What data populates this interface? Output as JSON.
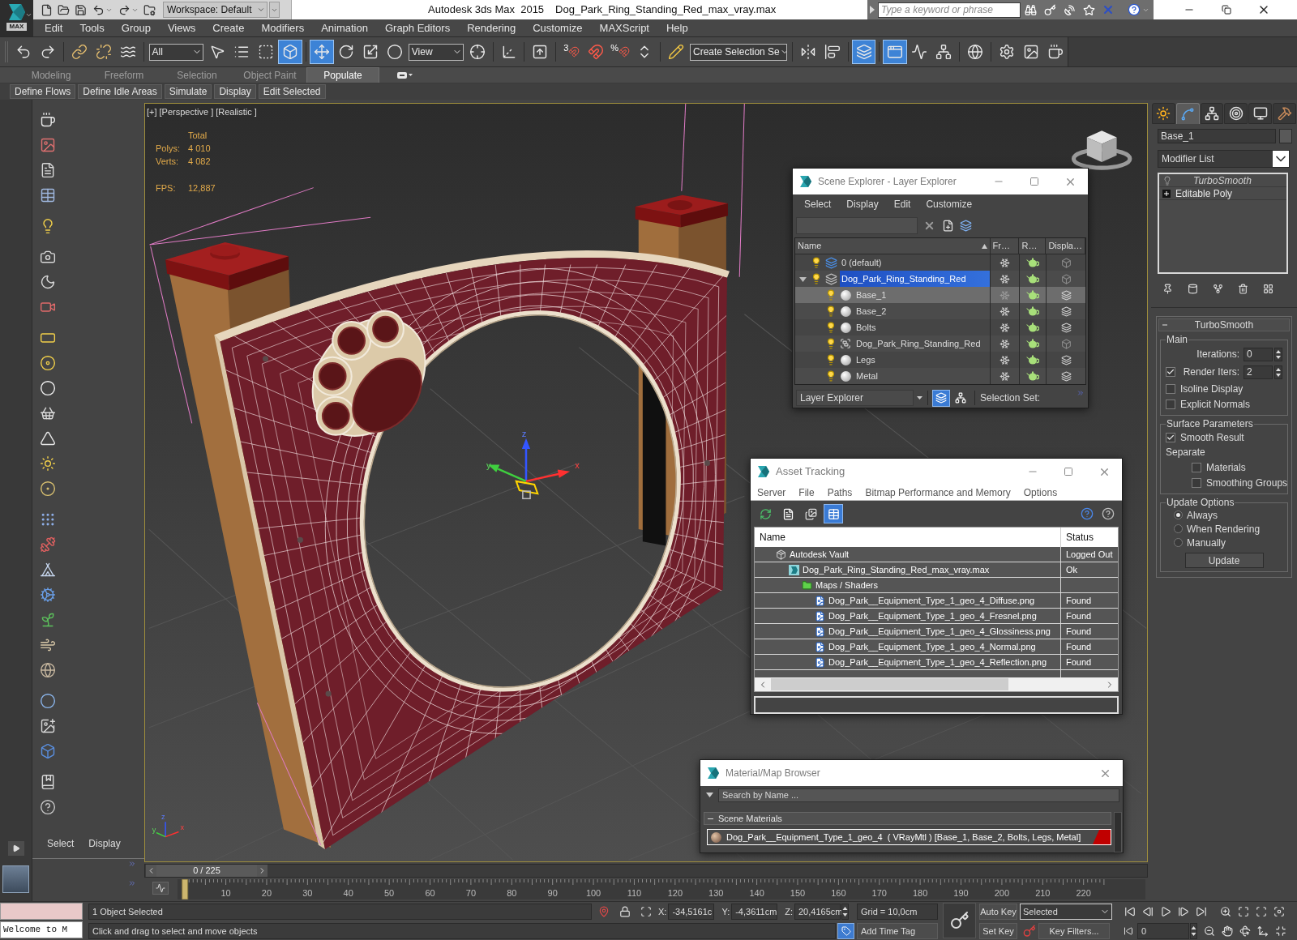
{
  "title_bar": {
    "logo_label": "MAX",
    "workspace": "Workspace: Default",
    "app_title": "Autodesk 3ds Max  2015",
    "file_name": "Dog_Park_Ring_Standing_Red_max_vray.max",
    "search_placeholder": "Type a keyword or phrase"
  },
  "menu_bar": [
    "Edit",
    "Tools",
    "Group",
    "Views",
    "Create",
    "Modifiers",
    "Animation",
    "Graph Editors",
    "Rendering",
    "Customize",
    "MAXScript",
    "Help"
  ],
  "main_toolbar": {
    "selection_filter": "All",
    "reference_coordinate_system": "View",
    "snap_label": "3",
    "percent_snap_label": "%",
    "named_selection_set": "Create Selection Se",
    "buttons": [
      {
        "active": false
      },
      {
        "active": false
      },
      {
        "active": false
      },
      {
        "active": false
      },
      {
        "active": false
      },
      {
        "active": false
      },
      {
        "active": false
      },
      {
        "active": false
      },
      {
        "active": true
      },
      {
        "active": true
      },
      {
        "active": false
      },
      {
        "active": false
      },
      {
        "active": false
      },
      {
        "active": false
      },
      {
        "active": false
      },
      {
        "active": false
      },
      {
        "active": false
      },
      {
        "active": false
      },
      {
        "active": false
      },
      {
        "active": false
      },
      {
        "active": false
      },
      {
        "active": false
      },
      {
        "active": false
      },
      {
        "active": true
      },
      {
        "active": true
      },
      {
        "active": false
      },
      {
        "active": false
      },
      {
        "active": false
      },
      {
        "active": false
      },
      {
        "active": false
      },
      {
        "active": false
      }
    ]
  },
  "ribbon": {
    "tabs": [
      {
        "label": "Modeling",
        "selected": false
      },
      {
        "label": "Freeform",
        "selected": false
      },
      {
        "label": "Selection",
        "selected": false
      },
      {
        "label": "Object Paint",
        "selected": false
      },
      {
        "label": "Populate",
        "selected": true
      }
    ],
    "buttons": [
      "Define Flows",
      "Define Idle Areas",
      "Simulate",
      "Display",
      "Edit Selected"
    ]
  },
  "left_panel": {
    "tabs": [
      "Select",
      "Display"
    ]
  },
  "viewport": {
    "labels": [
      "[+]",
      "[Perspective ]",
      "[Realistic ]"
    ],
    "stats_heading": "Total",
    "stats": [
      {
        "label": "Polys:",
        "value": "4 010"
      },
      {
        "label": "Verts:",
        "value": "4 082"
      }
    ],
    "fps": {
      "label": "FPS:",
      "value": "12,887"
    },
    "gizmo_axes": [
      "x",
      "y",
      "z"
    ],
    "tripod_axes": [
      "x",
      "y",
      "z"
    ]
  },
  "scene_explorer": {
    "title": "Scene Explorer - Layer Explorer",
    "menu": [
      "Select",
      "Display",
      "Edit",
      "Customize"
    ],
    "columns": [
      "Name",
      "Fr…",
      "R…",
      "Displa…"
    ],
    "rows": [
      {
        "name": "0 (default)",
        "kind": "layer",
        "current": true,
        "selected": false
      },
      {
        "name": "Dog_Park_Ring_Standing_Red",
        "kind": "layer",
        "current": false,
        "selected": true,
        "expanded": true,
        "children": [
          {
            "name": "Base_1",
            "kind": "object",
            "selected": true
          },
          {
            "name": "Base_2",
            "kind": "object",
            "selected": false
          },
          {
            "name": "Bolts",
            "kind": "object",
            "selected": false
          },
          {
            "name": "Dog_Park_Ring_Standing_Red",
            "kind": "group",
            "selected": false
          },
          {
            "name": "Legs",
            "kind": "object",
            "selected": false
          },
          {
            "name": "Metal",
            "kind": "object",
            "selected": false
          }
        ]
      }
    ],
    "footer": {
      "explorer": "Layer Explorer",
      "view_buttons": [
        {
          "active": true
        },
        {
          "active": false
        }
      ],
      "selection_set_label": "Selection Set:"
    }
  },
  "asset_tracking": {
    "title": "Asset Tracking",
    "menu": [
      "Server",
      "File",
      "Paths",
      "Bitmap Performance and Memory",
      "Options"
    ],
    "toolbar": [
      {
        "active": false
      },
      {
        "active": false
      },
      {
        "active": false
      },
      {
        "active": true
      }
    ],
    "columns": [
      "Name",
      "Status"
    ],
    "rows": [
      {
        "name": "Autodesk Vault",
        "kind": "vault",
        "status": "Logged Out",
        "children": [
          {
            "name": "Dog_Park_Ring_Standing_Red_max_vray.max",
            "kind": "scene_file",
            "status": "Ok",
            "children": [
              {
                "name": "Maps / Shaders",
                "kind": "folder",
                "children": [
                  {
                    "name": "Dog_Park__Equipment_Type_1_geo_4_Diffuse.png",
                    "kind": "bitmap",
                    "status": "Found"
                  },
                  {
                    "name": "Dog_Park__Equipment_Type_1_geo_4_Fresnel.png",
                    "kind": "bitmap",
                    "status": "Found"
                  },
                  {
                    "name": "Dog_Park__Equipment_Type_1_geo_4_Glossiness.png",
                    "kind": "bitmap",
                    "status": "Found"
                  },
                  {
                    "name": "Dog_Park__Equipment_Type_1_geo_4_Normal.png",
                    "kind": "bitmap",
                    "status": "Found"
                  },
                  {
                    "name": "Dog_Park__Equipment_Type_1_geo_4_Reflection.png",
                    "kind": "bitmap",
                    "status": "Found"
                  }
                ]
              }
            ]
          }
        ]
      }
    ]
  },
  "material_browser": {
    "title": "Material/Map Browser",
    "search_placeholder": "Search by Name ...",
    "groups": [
      {
        "label": "Scene Materials",
        "expanded": true,
        "items": [
          {
            "name": "Dog_Park__Equipment_Type_1_geo_4  ( VRayMtl ) [Base_1, Base_2, Bolts, Legs, Metal]",
            "selected": true
          }
        ]
      }
    ]
  },
  "command_panel": {
    "tabs": [
      {
        "selected": false
      },
      {
        "selected": true
      },
      {
        "selected": false
      },
      {
        "selected": false
      },
      {
        "selected": false
      },
      {
        "selected": false
      }
    ],
    "object_name": "Base_1",
    "modifier_list": "Modifier List",
    "stack": [
      {
        "name": "TurboSmooth",
        "kind": "modifier",
        "viewport_enabled": false
      },
      {
        "name": "Editable Poly",
        "kind": "base_object",
        "expanded": false
      }
    ],
    "rollout": {
      "title": "TurboSmooth",
      "expanded": true,
      "groups": [
        {
          "title": "Main",
          "controls": [
            {
              "kind": "spinner",
              "label": "Iterations:",
              "value": "0"
            },
            {
              "kind": "check_spinner",
              "label": "Render Iters:",
              "value": "2",
              "checked": true
            },
            {
              "kind": "checkbox",
              "label": "Isoline Display",
              "checked": false
            },
            {
              "kind": "checkbox",
              "label": "Explicit Normals",
              "checked": false
            }
          ]
        },
        {
          "title": "Surface Parameters",
          "controls": [
            {
              "kind": "checkbox",
              "label": "Smooth Result",
              "checked": true
            },
            {
              "kind": "label",
              "label": "Separate",
              "children": [
                {
                  "kind": "checkbox",
                  "label": "Materials",
                  "checked": false
                },
                {
                  "kind": "checkbox",
                  "label": "Smoothing Groups",
                  "checked": false
                }
              ]
            }
          ]
        },
        {
          "title": "Update Options",
          "controls": [
            {
              "kind": "radio",
              "label": "Always",
              "selected": true
            },
            {
              "kind": "radio",
              "label": "When Rendering",
              "selected": false
            },
            {
              "kind": "radio",
              "label": "Manually",
              "selected": false
            },
            {
              "kind": "button",
              "label": "Update"
            }
          ]
        }
      ]
    }
  },
  "time_slider": {
    "label": "0 / 225",
    "level": 0
  },
  "track_bar": {
    "frame_numbers": [
      "10",
      "20",
      "30",
      "40",
      "50",
      "60",
      "70",
      "80",
      "90",
      "100",
      "110",
      "120",
      "130",
      "140",
      "150",
      "160",
      "170",
      "180",
      "190",
      "200",
      "210",
      "220"
    ]
  },
  "status_bar": {
    "listener_output": "Welcome to M",
    "prompt": "1 Object Selected",
    "hint": "Click and drag to select and move objects",
    "coordinates": [
      {
        "axis": "X:",
        "value": "-34,5161c"
      },
      {
        "axis": "Y:",
        "value": "-4,3611cm"
      },
      {
        "axis": "Z:",
        "value": "20,4165cm"
      }
    ],
    "grid": "Grid = 10,0cm",
    "add_time_tag": "Add Time Tag",
    "auto_key": "Auto Key",
    "set_key": "Set Key",
    "key_mode": "Selected",
    "key_filters": "Key Filters...",
    "current_frame": "0"
  }
}
